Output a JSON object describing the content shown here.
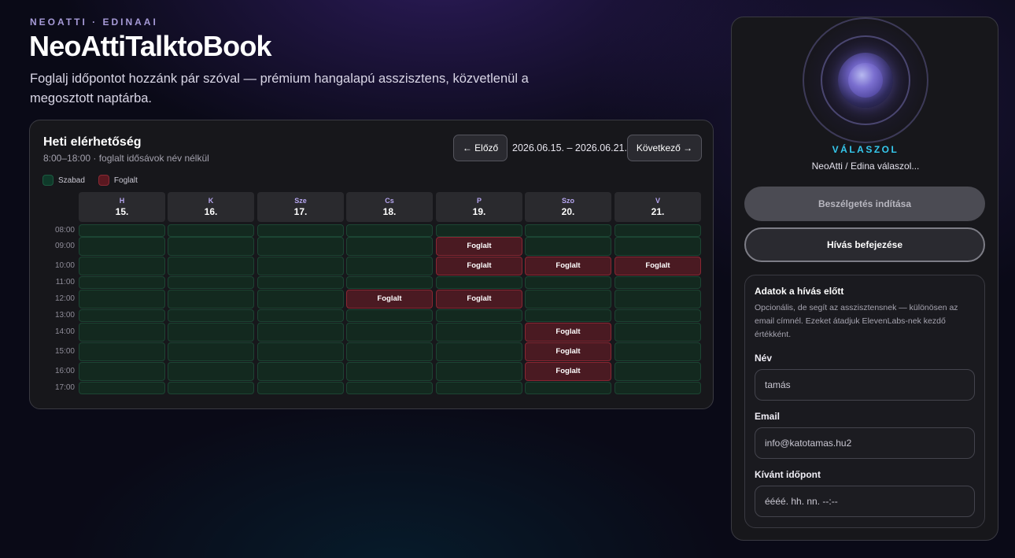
{
  "header": {
    "kicker": "NEOATTI · EDINAAI",
    "title": "NeoAttiTalktoBook",
    "subtitle": "Foglalj időpontot hozzánk pár szóval — prémium hangalapú asszisztens, közvetlenül a megosztott naptárba."
  },
  "calendar": {
    "title": "Heti elérhetőség",
    "subtitle": "8:00–18:00 · foglalt idősávok név nélkül",
    "prev_label": "← Előző",
    "next_label": "Következő →",
    "range": "2026.06.15. – 2026.06.21.",
    "legend": {
      "free": "Szabad",
      "busy": "Foglalt"
    },
    "days": [
      {
        "name": "H",
        "date": "15."
      },
      {
        "name": "K",
        "date": "16."
      },
      {
        "name": "Sze",
        "date": "17."
      },
      {
        "name": "Cs",
        "date": "18."
      },
      {
        "name": "P",
        "date": "19."
      },
      {
        "name": "Szo",
        "date": "20."
      },
      {
        "name": "V",
        "date": "21."
      }
    ],
    "hours": [
      "08:00",
      "09:00",
      "10:00",
      "11:00",
      "12:00",
      "13:00",
      "14:00",
      "15:00",
      "16:00",
      "17:00"
    ],
    "busy_label": "Foglalt",
    "busy": [
      {
        "day": 4,
        "hour": 1
      },
      {
        "day": 4,
        "hour": 2
      },
      {
        "day": 5,
        "hour": 2
      },
      {
        "day": 6,
        "hour": 2
      },
      {
        "day": 3,
        "hour": 4
      },
      {
        "day": 4,
        "hour": 4
      },
      {
        "day": 5,
        "hour": 6
      },
      {
        "day": 5,
        "hour": 7
      },
      {
        "day": 5,
        "hour": 8
      }
    ]
  },
  "assistant": {
    "status": "VÁLASZOL",
    "status_sub": "NeoAtti / Edina válaszol...",
    "start_label": "Beszélgetés indítása",
    "end_label": "Hívás befejezése"
  },
  "form": {
    "title": "Adatok a hívás előtt",
    "description": "Opcionális, de segít az asszisztensnek — különösen az email címnél. Ezeket átadjuk ElevenLabs-nek kezdő értékként.",
    "name_label": "Név",
    "name_value": "tamás",
    "email_label": "Email",
    "email_value": "info@katotamas.hu2",
    "date_label": "Kívánt időpont",
    "date_value": "éééé. hh. nn. --:--"
  },
  "colors": {
    "accent": "#35c9ee",
    "free": "#13291f",
    "busy": "#4a1a22"
  }
}
